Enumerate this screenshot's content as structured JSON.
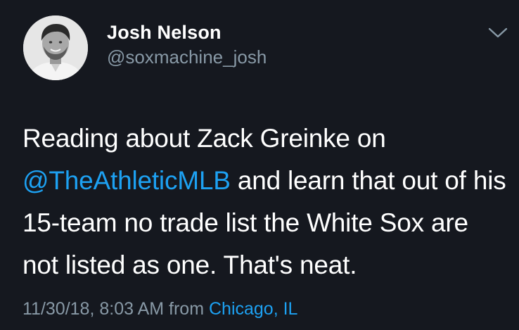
{
  "colors": {
    "background": "#15181f",
    "text": "#ffffff",
    "secondary": "#8899a6",
    "accent": "#1da1f2"
  },
  "author": {
    "name": "Josh Nelson",
    "handle": "@soxmachine_josh"
  },
  "tweet": {
    "text_before_mention": "Reading about Zack Greinke on",
    "mention": "@TheAthleticMLB",
    "text_after_mention": " and learn that out of his 15-team no trade list the White Sox are not listed as one. That's neat."
  },
  "meta": {
    "timestamp": "11/30/18, 8:03 AM",
    "from_label": "from",
    "location": "Chicago, IL"
  },
  "icons": {
    "menu": "chevron-down-icon",
    "avatar": "profile-photo"
  }
}
